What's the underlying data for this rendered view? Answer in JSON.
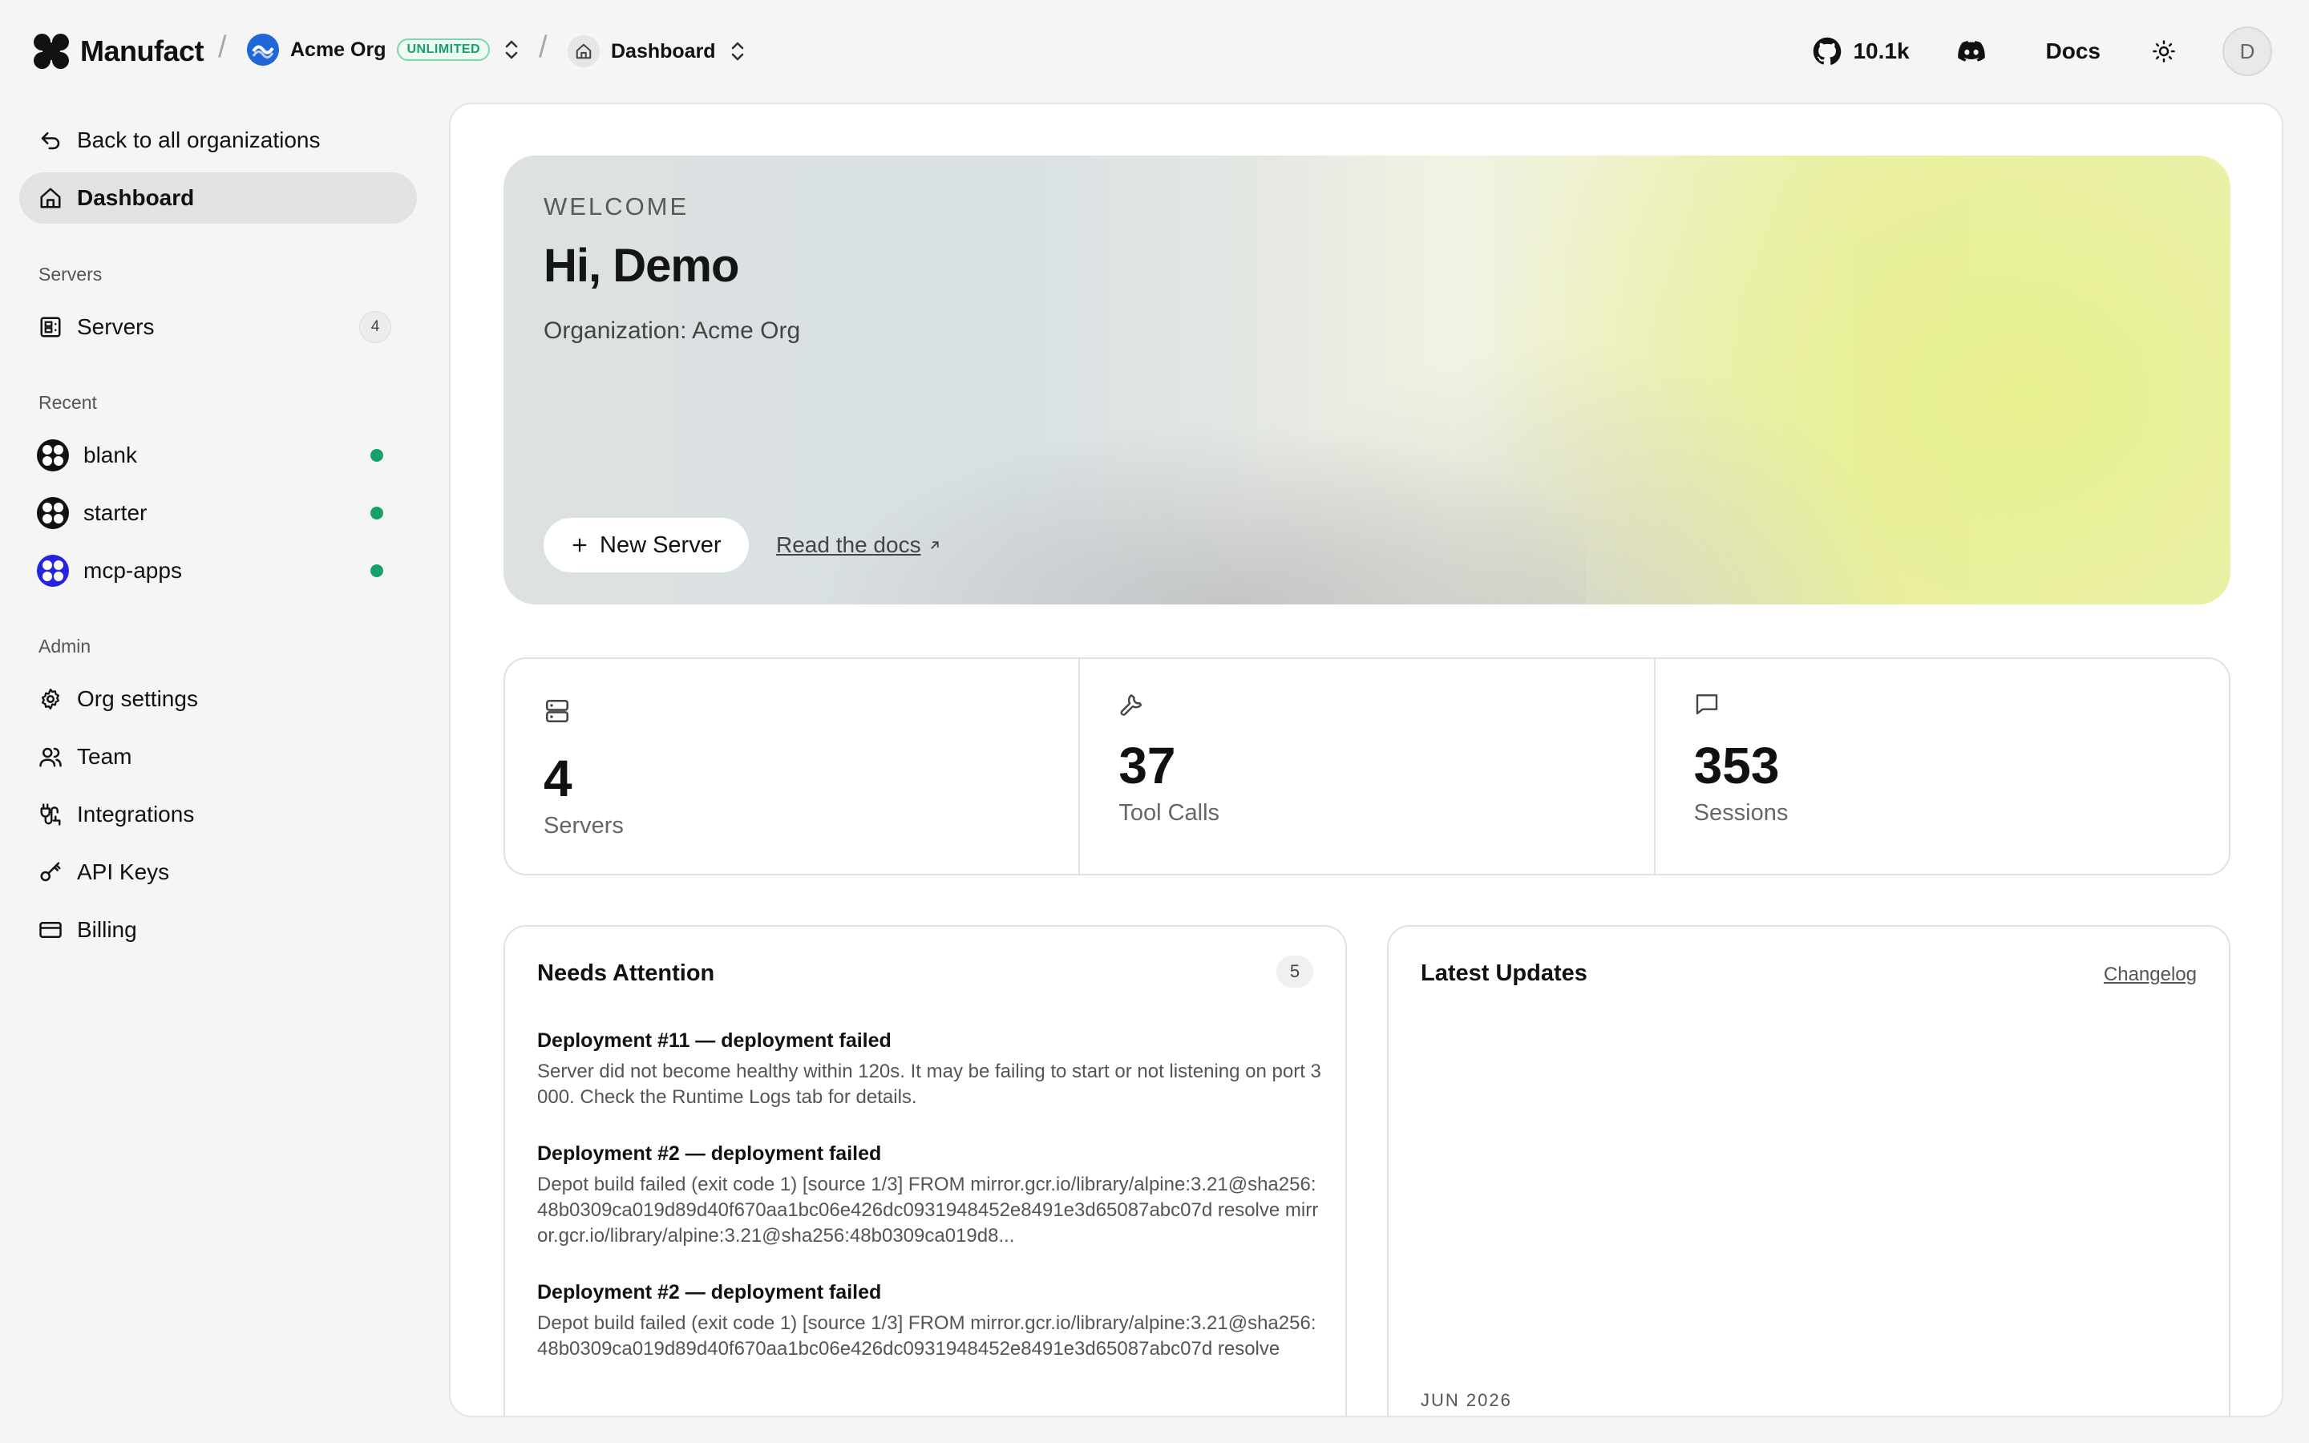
{
  "topbar": {
    "brand": "Manufact",
    "org_name": "Acme Org",
    "org_badge": "UNLIMITED",
    "crumb": "Dashboard",
    "github_count": "10.1k",
    "docs": "Docs",
    "avatar_initial": "D"
  },
  "sidebar": {
    "back": "Back to all organizations",
    "dashboard": "Dashboard",
    "servers_section": "Servers",
    "servers_item": "Servers",
    "servers_count": "4",
    "recent_section": "Recent",
    "recent": [
      {
        "label": "blank",
        "status": "online"
      },
      {
        "label": "starter",
        "status": "online"
      },
      {
        "label": "mcp-apps",
        "status": "online"
      }
    ],
    "admin_section": "Admin",
    "admin": [
      {
        "label": "Org settings",
        "icon": "gear-icon"
      },
      {
        "label": "Team",
        "icon": "team-icon"
      },
      {
        "label": "Integrations",
        "icon": "plug-icon"
      },
      {
        "label": "API Keys",
        "icon": "key-icon"
      },
      {
        "label": "Billing",
        "icon": "card-icon"
      }
    ]
  },
  "hero": {
    "eyebrow": "WELCOME",
    "title": "Hi, Demo",
    "subtitle": "Organization: Acme Org",
    "new_server": "New Server",
    "read_docs": "Read the docs"
  },
  "stats": [
    {
      "value": "4",
      "label": "Servers",
      "icon": "server-icon"
    },
    {
      "value": "37",
      "label": "Tool Calls",
      "icon": "wrench-icon"
    },
    {
      "value": "353",
      "label": "Sessions",
      "icon": "chat-icon"
    }
  ],
  "attention": {
    "title": "Needs Attention",
    "count": "5",
    "items": [
      {
        "title": "Deployment #11 — deployment failed",
        "body": "Server did not become healthy within 120s. It may be failing to start or not listening on port 3000. Check the Runtime Logs tab for details."
      },
      {
        "title": "Deployment #2 — deployment failed",
        "body": "Depot build failed (exit code 1) [source 1/3] FROM mirror.gcr.io/library/alpine:3.21@sha256:48b0309ca019d89d40f670aa1bc06e426dc0931948452e8491e3d65087abc07d resolve mirror.gcr.io/library/alpine:3.21@sha256:48b0309ca019d8..."
      },
      {
        "title": "Deployment #2 — deployment failed",
        "body": "Depot build failed (exit code 1) [source 1/3] FROM mirror.gcr.io/library/alpine:3.21@sha256:48b0309ca019d89d40f670aa1bc06e426dc0931948452e8491e3d65087abc07d resolve"
      }
    ]
  },
  "updates": {
    "title": "Latest Updates",
    "changelog": "Changelog",
    "month": "JUN 2026"
  }
}
